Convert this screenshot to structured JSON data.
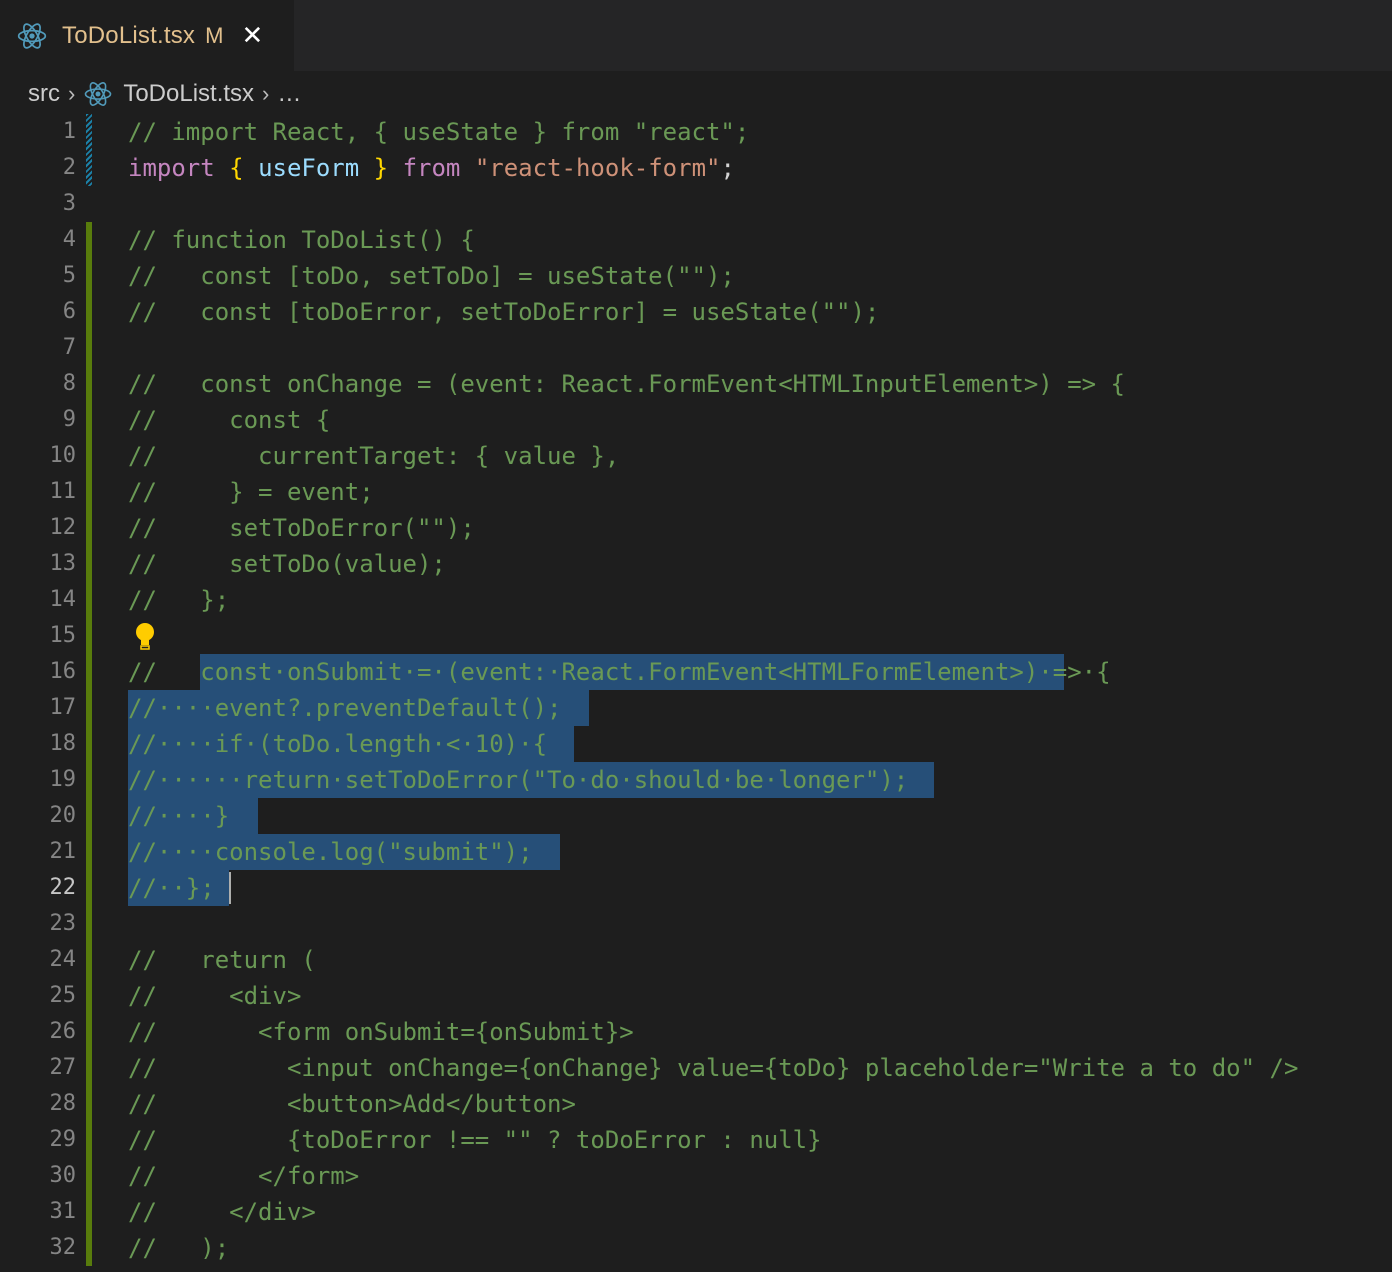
{
  "tab": {
    "filename": "ToDoList.tsx",
    "badge": "M",
    "close_glyph": "✕",
    "icon": "react-icon"
  },
  "breadcrumb": {
    "folder": "src",
    "file": "ToDoList.tsx",
    "more": "…",
    "separator": "›"
  },
  "colors": {
    "accent_modified": "#e2c08d",
    "comment": "#6a9955",
    "selection": "#264f78",
    "gutter_added": "#587c0c",
    "gutter_modified": "#1b81a8"
  },
  "editor": {
    "active_line": 22,
    "lines": [
      "// import React, { useState } from \"react\";",
      "import { useForm } from \"react-hook-form\";",
      "",
      "// function ToDoList() {",
      "//   const [toDo, setToDo] = useState(\"\");",
      "//   const [toDoError, setToDoError] = useState(\"\");",
      "",
      "//   const onChange = (event: React.FormEvent<HTMLInputElement>) => {",
      "//     const {",
      "//       currentTarget: { value },",
      "//     } = event;",
      "//     setToDoError(\"\");",
      "//     setToDo(value);",
      "//   };",
      "",
      "//   const·onSubmit·=·(event:·React.FormEvent<HTMLFormElement>)·=>·{",
      "//····event?.preventDefault();",
      "//····if·(toDo.length·<·10)·{",
      "//······return·setToDoError(\"To·do·should·be·longer\");",
      "//····}",
      "//····console.log(\"submit\");",
      "//··};",
      "",
      "//   return (",
      "//     <div>",
      "//       <form onSubmit={onSubmit}>",
      "//         <input onChange={onChange} value={toDo} placeholder=\"Write a to do\" />",
      "//         <button>Add</button>",
      "//         {toDoError !== \"\" ? toDoError : null}",
      "//       </form>",
      "//     </div>",
      "//   );"
    ]
  }
}
